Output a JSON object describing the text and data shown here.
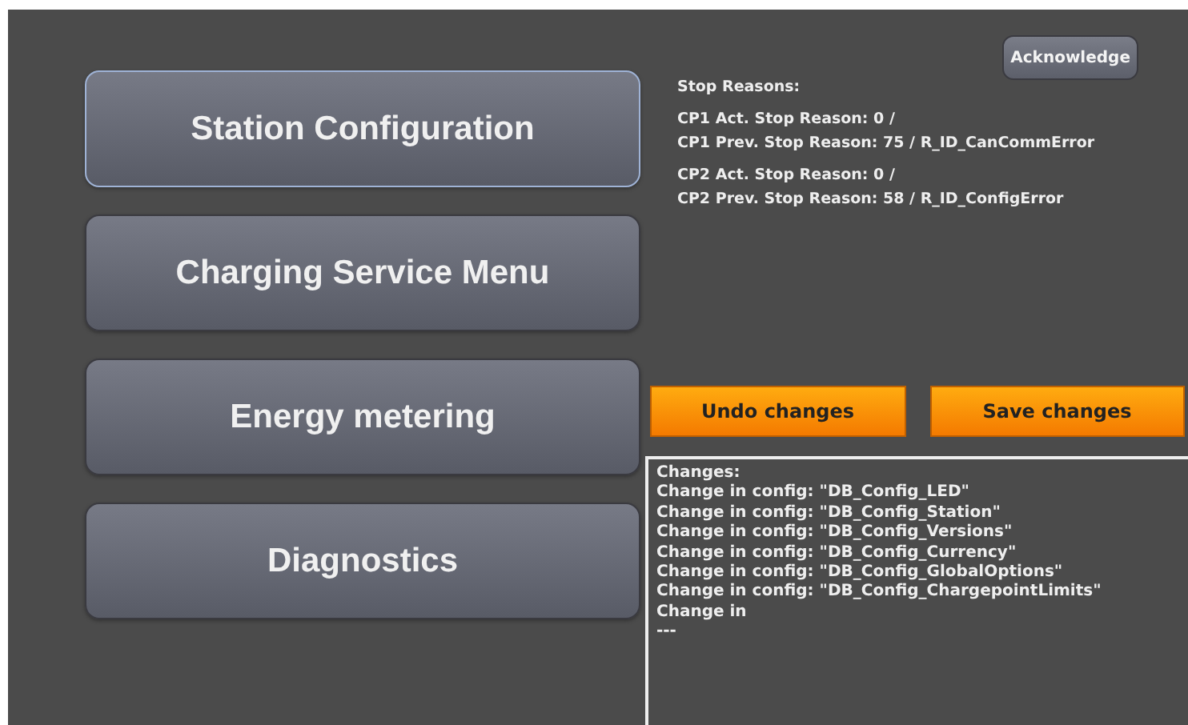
{
  "menu": [
    {
      "label": "Station Configuration",
      "selected": true
    },
    {
      "label": "Charging Service Menu",
      "selected": false
    },
    {
      "label": "Energy metering",
      "selected": false
    },
    {
      "label": "Diagnostics",
      "selected": false
    }
  ],
  "acknowledge_button": "Acknowledge",
  "stop_reasons": {
    "title": "Stop Reasons:",
    "groups": [
      [
        "CP1 Act. Stop Reason: 0 /",
        "CP1 Prev. Stop Reason: 75 / R_ID_CanCommError"
      ],
      [
        "CP2 Act. Stop Reason: 0 /",
        "CP2 Prev. Stop Reason: 58 / R_ID_ConfigError"
      ]
    ]
  },
  "undo_button": "Undo changes",
  "save_button": "Save changes",
  "changes_log": [
    "Changes:",
    "Change in config: \"DB_Config_LED\"",
    "Change in config: \"DB_Config_Station\"",
    "Change in config: \"DB_Config_Versions\"",
    "Change in config: \"DB_Config_Currency\"",
    "Change in config: \"DB_Config_GlobalOptions\"",
    "Change in config: \"DB_Config_ChargepointLimits\"",
    "Change in",
    "---"
  ]
}
